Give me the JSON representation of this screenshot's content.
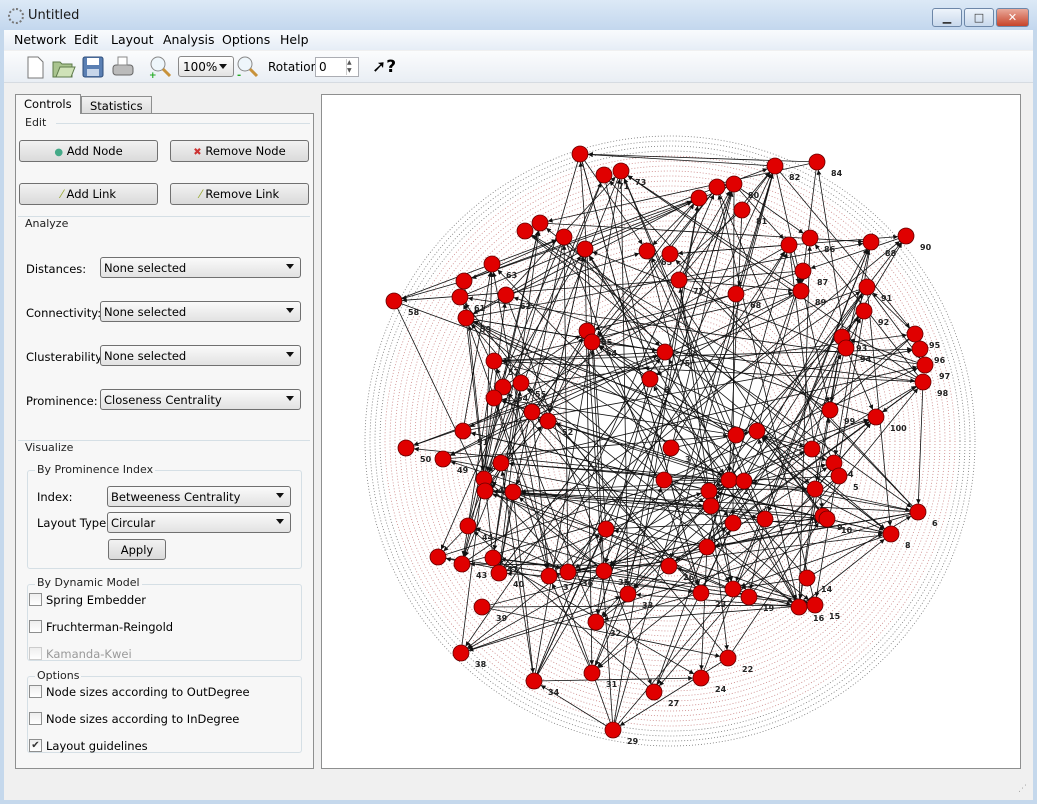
{
  "window": {
    "title": "Untitled",
    "minimize": "▁",
    "maximize": "□",
    "close": "✕"
  },
  "menu": [
    "Network",
    "Edit",
    "Layout",
    "Analysis",
    "Options",
    "Help"
  ],
  "toolbar": {
    "zoom": "100%",
    "rotation_label": "Rotation:",
    "rotation_value": "0",
    "icons": [
      "new-file-icon",
      "open-folder-icon",
      "save-icon",
      "print-icon",
      "zoom-in-icon",
      "zoom-out-icon",
      "whats-this-help-icon"
    ]
  },
  "tabs": [
    "Controls",
    "Statistics"
  ],
  "controls": {
    "edit_title": "Edit",
    "add_node": "Add Node",
    "remove_node": "Remove Node",
    "add_link": "Add Link",
    "remove_link": "Remove Link",
    "analyze_title": "Analyze",
    "distances_label": "Distances:",
    "distances_value": "None selected",
    "connectivity_label": "Connectivity:",
    "connectivity_value": "None selected",
    "clusterability_label": "Clusterability:",
    "clusterability_value": "None selected",
    "prominence_label": "Prominence:",
    "prominence_value": "Closeness Centrality",
    "visualize_title": "Visualize",
    "by_prominence_title": "By Prominence Index",
    "index_label": "Index:",
    "index_value": "Betweeness Centrality",
    "layout_type_label": "Layout Type:",
    "layout_type_value": "Circular",
    "apply": "Apply",
    "dynamic_title": "By Dynamic Model",
    "spring": "Spring Embedder",
    "fruchterman": "Fruchterman-Reingold",
    "kamada": "Kamanda-Kwei",
    "options_title": "Options",
    "out_degree": "Node sizes according to OutDegree",
    "in_degree": "Node sizes according to InDegree",
    "guidelines": "Layout guidelines",
    "checked": {
      "spring": false,
      "fruchterman": false,
      "kamada": false,
      "out_degree": false,
      "in_degree": false,
      "guidelines": true
    }
  },
  "graph": {
    "node_color": "#e00000",
    "guide_color": "#a02020",
    "node_labels": [
      "",
      "71",
      "73",
      "",
      "",
      "80",
      "81",
      "82",
      "84",
      "",
      "",
      "66",
      "",
      "65",
      "",
      "77",
      "63",
      "",
      "61",
      "62",
      "59",
      "58",
      "85",
      "64",
      "75",
      "6",
      "68",
      "",
      "86",
      "87",
      "89",
      "88",
      "90",
      "91",
      "92",
      "93",
      "94",
      "95",
      "96",
      "97",
      "98",
      "99",
      "100",
      "",
      "",
      "3",
      "57",
      "55",
      "54",
      "",
      "53",
      "52",
      "51",
      "50",
      "49",
      "",
      "48",
      "",
      "",
      "",
      "4",
      "5",
      "",
      "6",
      "8",
      "9",
      "10",
      "14",
      "15",
      "16",
      "",
      "",
      "",
      "2",
      "",
      "7",
      "",
      "",
      "26",
      "",
      "44",
      "41",
      "40",
      "",
      "43",
      "39",
      "38",
      "37",
      "36",
      "35",
      "33",
      "32",
      "23",
      "",
      "19",
      "31",
      "34",
      "27",
      "24",
      "22",
      "29"
    ]
  }
}
